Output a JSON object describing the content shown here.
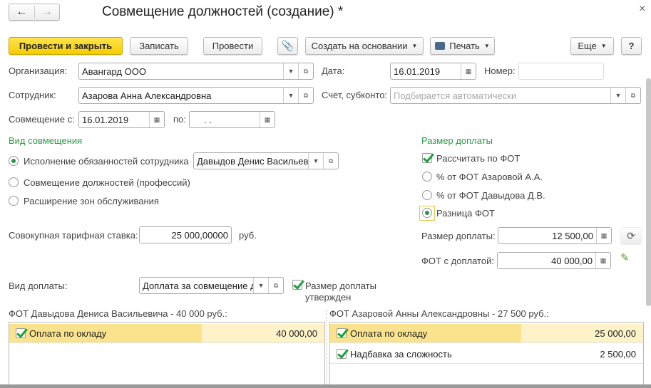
{
  "window": {
    "title": "Совмещение должностей (создание) *",
    "close": "×",
    "back": "←",
    "forward": "→"
  },
  "toolbar": {
    "post_close": "Провести и закрыть",
    "save": "Записать",
    "post": "Провести",
    "create_based": "Создать на основании",
    "print": "Печать",
    "more": "Еще",
    "help": "?"
  },
  "header": {
    "org_label": "Организация:",
    "org_value": "Авангард ООО",
    "date_label": "Дата:",
    "date_value": "16.01.2019",
    "number_label": "Номер:",
    "number_value": "",
    "employee_label": "Сотрудник:",
    "employee_value": "Азарова Анна Александровна",
    "account_label": "Счет, субконто:",
    "account_placeholder": "Подбирается автоматически",
    "from_label": "Совмещение с:",
    "from_value": "16.01.2019",
    "to_label": "по:",
    "to_value": " .  ."
  },
  "kind": {
    "title": "Вид совмещения",
    "options": [
      "Исполнение обязанностей сотрудника",
      "Совмещение должностей (профессий)",
      "Расширение зон обслуживания"
    ],
    "selected": 0,
    "employee_value": "Давыдов Денис Васильевич"
  },
  "surcharge": {
    "title": "Размер доплаты",
    "calc_by_fot": "Рассчитать по ФОТ",
    "calc_checked": true,
    "options": [
      "% от ФОТ Азаровой А.А.",
      "% от ФОТ Давыдова Д.В.",
      "Разница ФОТ"
    ],
    "selected": 2,
    "amount_label": "Размер доплаты:",
    "amount_value": "12 500,00",
    "fot_label": "ФОТ с доплатой:",
    "fot_value": "40 000,00"
  },
  "rate": {
    "label": "Совокупная тарифная ставка:",
    "value": "25 000,00000",
    "unit": "руб."
  },
  "payment_kind": {
    "label": "Вид доплаты:",
    "value": "Доплата за совмещение должностей",
    "approved_line1": "Размер доплаты",
    "approved_line2": "утвержден",
    "approved": true
  },
  "fot_left": {
    "title": "ФОТ Давыдова Дениса Васильевича - 40 000 руб.:",
    "rows": [
      {
        "name": "Оплата по окладу",
        "amount": "40 000,00",
        "checked": true
      }
    ]
  },
  "fot_right": {
    "title": "ФОТ Азаровой Анны Александровны - 27 500 руб.:",
    "rows": [
      {
        "name": "Оплата по окладу",
        "amount": "25 000,00",
        "checked": true
      },
      {
        "name": "Надбавка за сложность",
        "amount": "2 500,00",
        "checked": true
      }
    ]
  }
}
